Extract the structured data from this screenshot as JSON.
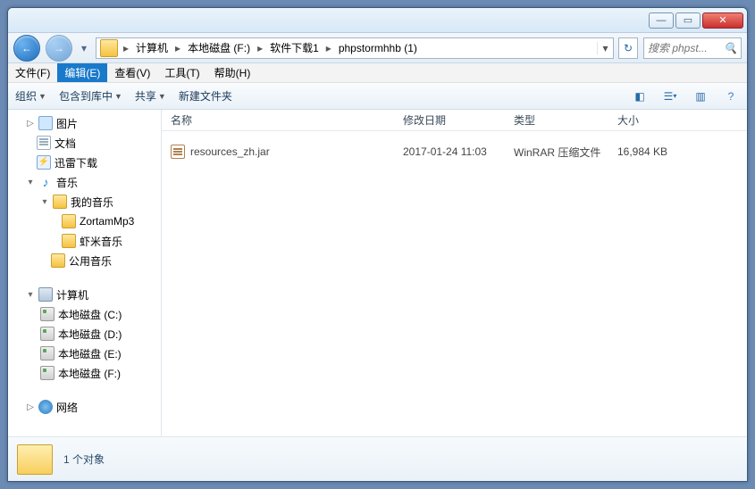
{
  "breadcrumb": {
    "segments": [
      "计算机",
      "本地磁盘 (F:)",
      "软件下载1",
      "phpstormhhb (1)"
    ]
  },
  "search": {
    "placeholder": "搜索 phpst..."
  },
  "menubar": {
    "items": [
      {
        "label": "文件(F)",
        "active": false
      },
      {
        "label": "编辑(E)",
        "active": true
      },
      {
        "label": "查看(V)",
        "active": false
      },
      {
        "label": "工具(T)",
        "active": false
      },
      {
        "label": "帮助(H)",
        "active": false
      }
    ]
  },
  "toolbar": {
    "organize": "组织",
    "include": "包含到库中",
    "share": "共享",
    "newfolder": "新建文件夹"
  },
  "columns": {
    "name": "名称",
    "date": "修改日期",
    "type": "类型",
    "size": "大小"
  },
  "tree": {
    "pictures": "图片",
    "documents": "文档",
    "xunlei": "迅雷下载",
    "music": "音乐",
    "mymusic": "我的音乐",
    "zortam": "ZortamMp3",
    "xiami": "虾米音乐",
    "publicmusic": "公用音乐",
    "computer": "计算机",
    "drive_c": "本地磁盘 (C:)",
    "drive_d": "本地磁盘 (D:)",
    "drive_e": "本地磁盘 (E:)",
    "drive_f": "本地磁盘 (F:)",
    "network": "网络"
  },
  "files": [
    {
      "name": "resources_zh.jar",
      "date": "2017-01-24 11:03",
      "type": "WinRAR 压缩文件",
      "size": "16,984 KB"
    }
  ],
  "status": {
    "count_label": "1 个对象"
  }
}
